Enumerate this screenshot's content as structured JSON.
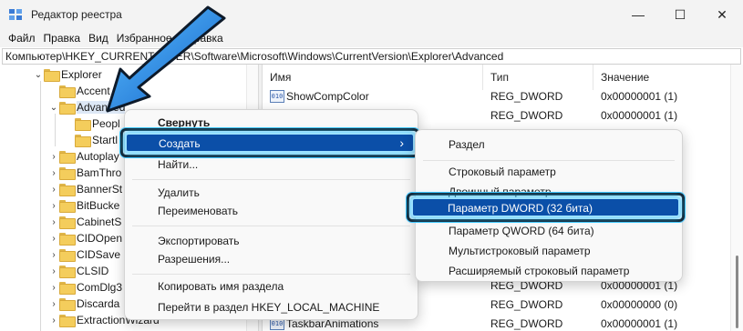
{
  "window": {
    "title": "Редактор реестра",
    "minimize_glyph": "—",
    "maximize_glyph": "☐",
    "close_glyph": "✕"
  },
  "menu": [
    "Файл",
    "Правка",
    "Вид",
    "Избранное",
    "Справка"
  ],
  "address": "Компьютер\\HKEY_CURRENT_USER\\Software\\Microsoft\\Windows\\CurrentVersion\\Explorer\\Advanced",
  "tree": [
    {
      "label": "Explorer",
      "chevron": "⌄"
    },
    {
      "label": "Accent",
      "chevron": ""
    },
    {
      "label": "Advanced",
      "chevron": "⌄",
      "selected": true
    },
    {
      "label": "Peopl",
      "chevron": ""
    },
    {
      "label": "Startl",
      "chevron": ""
    },
    {
      "label": "Autoplay",
      "chevron": "›"
    },
    {
      "label": "BamThro",
      "chevron": "›"
    },
    {
      "label": "BannerSt",
      "chevron": "›"
    },
    {
      "label": "BitBucke",
      "chevron": "›"
    },
    {
      "label": "CabinetS",
      "chevron": "›"
    },
    {
      "label": "CIDOpen",
      "chevron": "›"
    },
    {
      "label": "CIDSave",
      "chevron": "›"
    },
    {
      "label": "CLSID",
      "chevron": "›"
    },
    {
      "label": "ComDlg3",
      "chevron": "›"
    },
    {
      "label": "Discarda",
      "chevron": "›"
    },
    {
      "label": "ExtractionWizard",
      "chevron": "›"
    }
  ],
  "columns": {
    "name": "Имя",
    "type": "Тип",
    "value": "Значение"
  },
  "rows": [
    {
      "name": "ShowCompColor",
      "type": "REG_DWORD",
      "value": "0x00000001 (1)",
      "icon": "010"
    },
    {
      "name": "",
      "type": "REG_DWORD",
      "value": "0x00000001 (1)",
      "icon": ""
    },
    {
      "name": "",
      "type": "REG_DWORD",
      "value": "0x00000001 (1)",
      "icon": ""
    },
    {
      "name": "",
      "type": "REG_DWORD",
      "value": "0x00000000 (0)",
      "icon": ""
    },
    {
      "name": "TaskbarAnimations",
      "type": "REG_DWORD",
      "value": "0x00000001 (1)",
      "icon": "010"
    }
  ],
  "context_menu": {
    "collapse": "Свернуть",
    "create": "Создать",
    "create_arrow": "›",
    "find": "Найти...",
    "delete": "Удалить",
    "rename": "Переименовать",
    "export": "Экспортировать",
    "permissions": "Разрешения...",
    "copy_name": "Копировать имя раздела",
    "goto": "Перейти в раздел HKEY_LOCAL_MACHINE"
  },
  "submenu": {
    "key": "Раздел",
    "string": "Строковый параметр",
    "binary": "Двоичный параметр",
    "dword": "Параметр DWORD (32 бита)",
    "qword": "Параметр QWORD (64 бита)",
    "multistring": "Мультистроковый параметр",
    "expandstring": "Расширяемый строковый параметр"
  },
  "colors": {
    "highlight": "#0b4fa8",
    "glow": "#3ec6ff",
    "arrow": "#1e8fe8"
  }
}
